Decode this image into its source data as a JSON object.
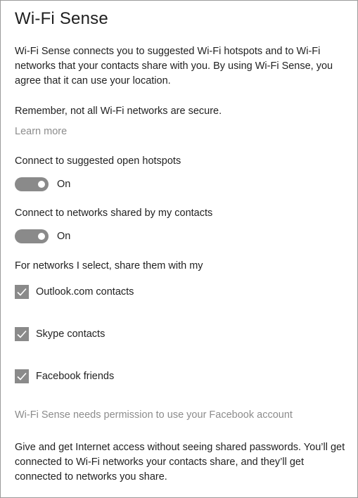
{
  "title": "Wi-Fi Sense",
  "intro": "Wi-Fi Sense connects you to suggested Wi-Fi hotspots and to Wi-Fi networks that your contacts share with you. By using Wi-Fi Sense, you agree that it can use your location.",
  "reminder": "Remember, not all Wi-Fi networks are secure.",
  "learn_more": "Learn more",
  "toggles": [
    {
      "label": "Connect to suggested open hotspots",
      "state": "On",
      "on": true
    },
    {
      "label": "Connect to networks shared by my contacts",
      "state": "On",
      "on": true
    }
  ],
  "share_heading": "For networks I select, share them with my",
  "share_options": [
    {
      "label": "Outlook.com contacts",
      "checked": true
    },
    {
      "label": "Skype contacts",
      "checked": true
    },
    {
      "label": "Facebook friends",
      "checked": true
    }
  ],
  "facebook_permission": "Wi-Fi Sense needs permission to use your Facebook account",
  "footer_text": "Give and get Internet access without seeing shared passwords. You’ll get connected to Wi-Fi networks your contacts share, and they’ll get connected to networks you share.",
  "colors": {
    "toggle_on": "#8a8a8a",
    "checkbox_fill": "#8a8a8a",
    "muted_text": "#8c8c8c",
    "body_text": "#222222"
  }
}
